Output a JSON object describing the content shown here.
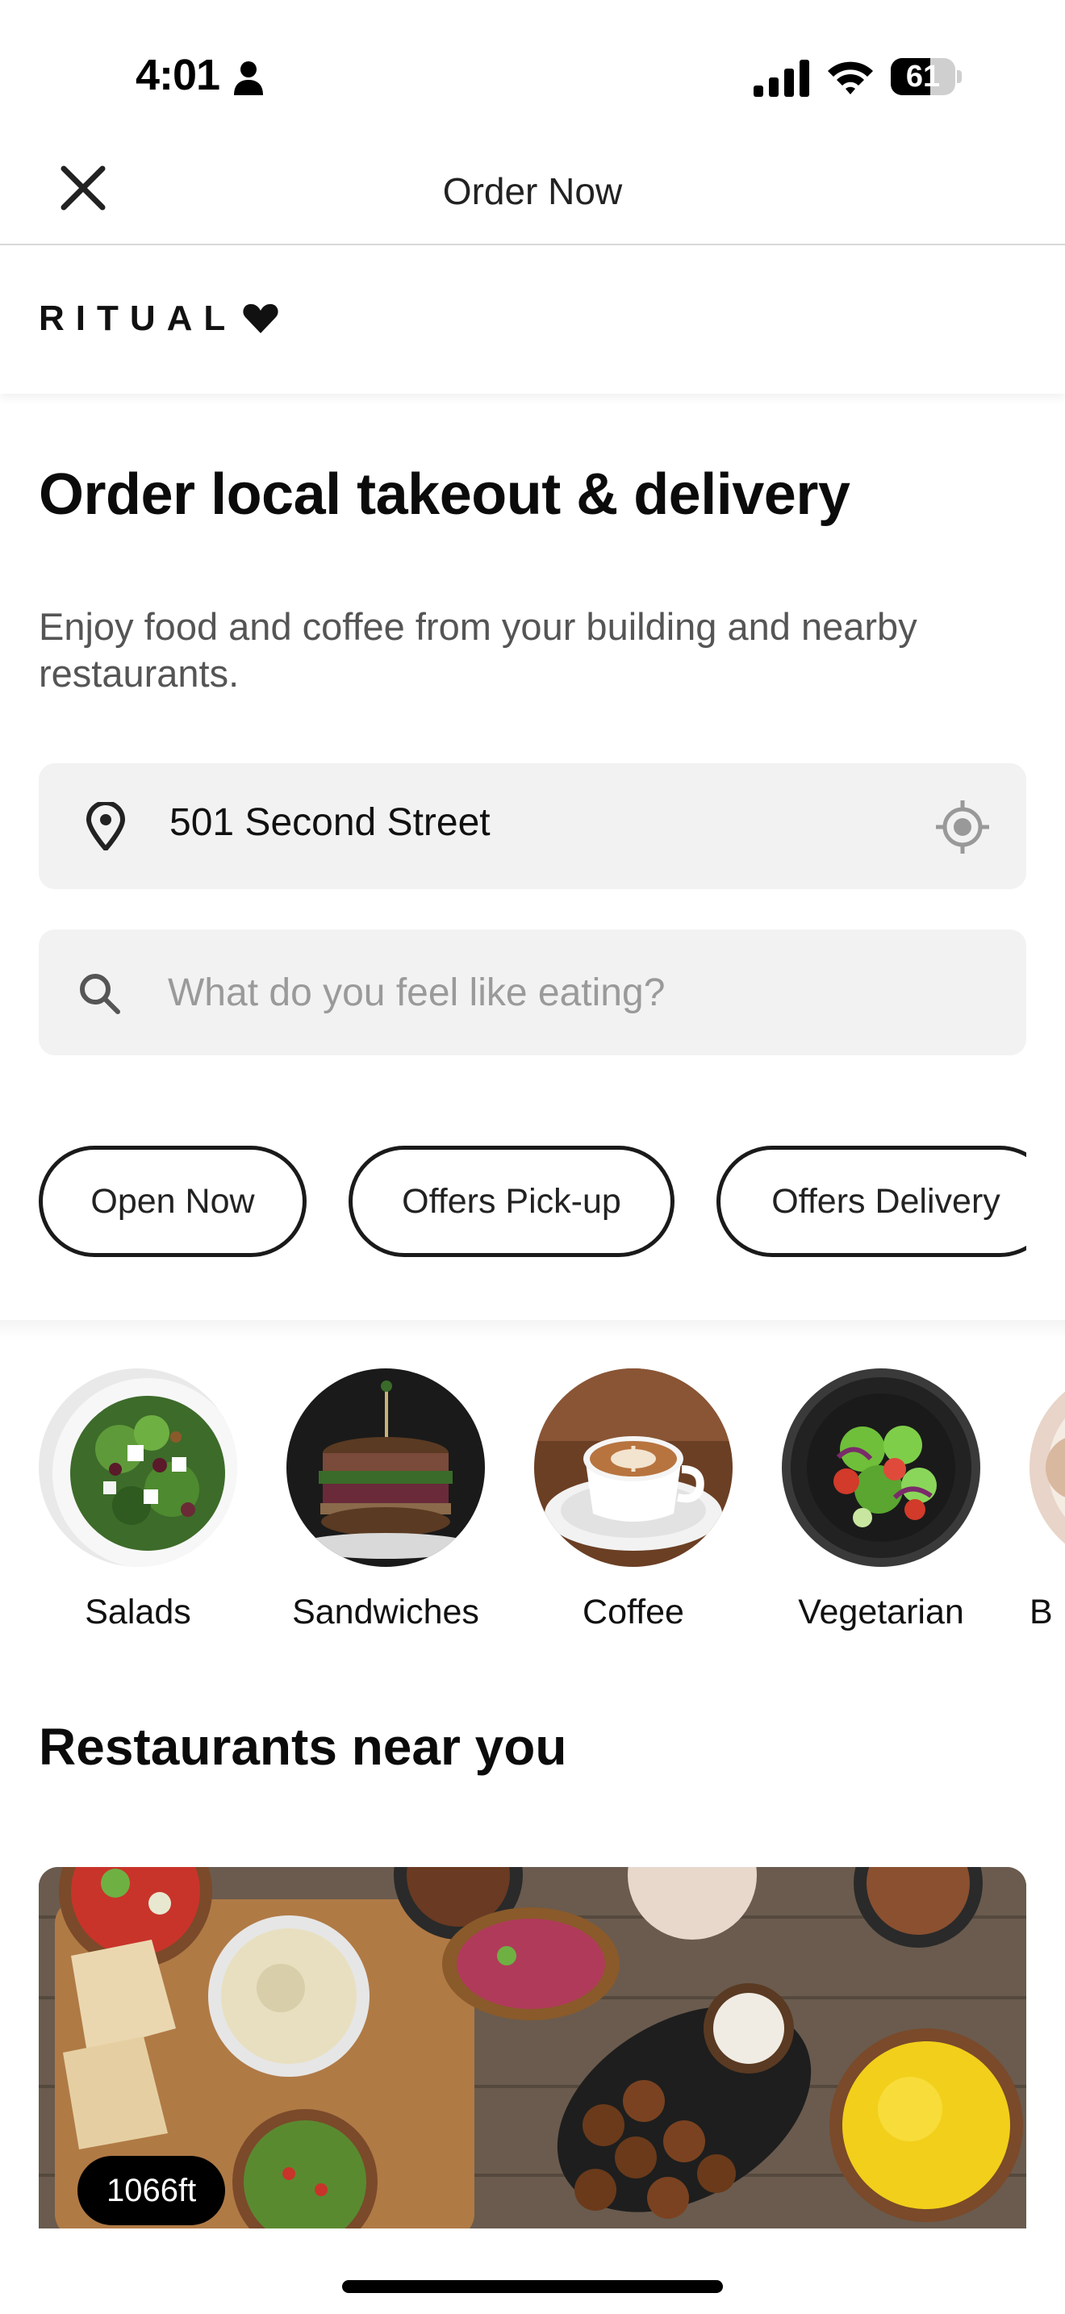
{
  "status_bar": {
    "time": "4:01",
    "battery_percent": 61,
    "battery_label": "61"
  },
  "header": {
    "title": "Order Now",
    "close_icon": "close-icon"
  },
  "brand": {
    "logo_text": "RITUAL"
  },
  "hero": {
    "title": "Order local takeout & delivery",
    "subtitle": "Enjoy food and coffee from your building and nearby restaurants."
  },
  "address": {
    "value": "501 Second Street",
    "icon": "map-pin-icon",
    "locate_icon": "crosshair-icon"
  },
  "search": {
    "placeholder": "What do you feel like eating?",
    "icon": "search-icon"
  },
  "filters": [
    {
      "label": "Open Now"
    },
    {
      "label": "Offers Pick-up"
    },
    {
      "label": "Offers Delivery"
    }
  ],
  "categories": [
    {
      "label": "Salads"
    },
    {
      "label": "Sandwiches"
    },
    {
      "label": "Coffee"
    },
    {
      "label": "Vegetarian"
    },
    {
      "label": "B"
    }
  ],
  "restaurants": {
    "title": "Restaurants near you",
    "items": [
      {
        "distance": "1066ft"
      }
    ]
  },
  "colors": {
    "text": "#111111",
    "field_bg": "#f2f2f2",
    "chip_border": "#1a1a1a"
  }
}
